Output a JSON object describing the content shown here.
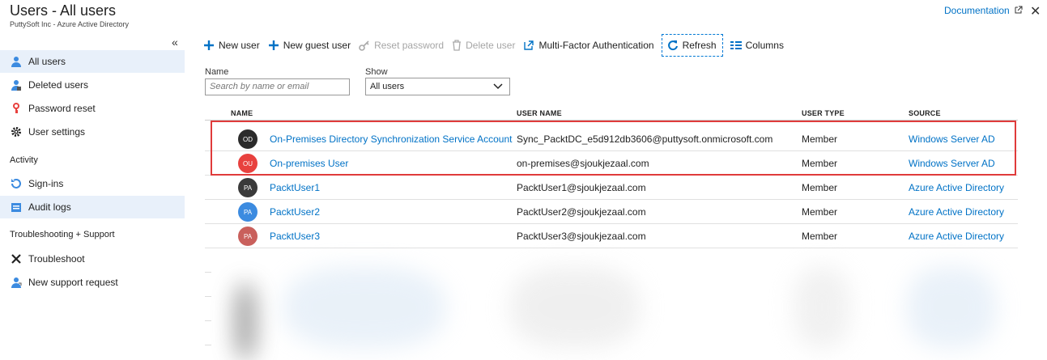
{
  "header": {
    "title": "Users - All users",
    "subtitle": "PuttySoft Inc - Azure Active Directory",
    "documentation": "Documentation",
    "close": "✕"
  },
  "sidebar": {
    "collapse": "«",
    "items": [
      {
        "label": "All users",
        "icon": "user-icon"
      },
      {
        "label": "Deleted users",
        "icon": "deleted-user-icon"
      },
      {
        "label": "Password reset",
        "icon": "key-icon"
      },
      {
        "label": "User settings",
        "icon": "gear-icon"
      }
    ],
    "activity_label": "Activity",
    "activity_items": [
      {
        "label": "Sign-ins",
        "icon": "sign-in-icon"
      },
      {
        "label": "Audit logs",
        "icon": "log-icon"
      }
    ],
    "support_label": "Troubleshooting + Support",
    "support_items": [
      {
        "label": "Troubleshoot",
        "icon": "wrench-icon"
      },
      {
        "label": "New support request",
        "icon": "support-icon"
      }
    ]
  },
  "toolbar": {
    "new_user": "New user",
    "new_guest_user": "New guest user",
    "reset_password": "Reset password",
    "delete_user": "Delete user",
    "mfa": "Multi-Factor Authentication",
    "refresh": "Refresh",
    "columns": "Columns"
  },
  "filters": {
    "name_label": "Name",
    "search_placeholder": "Search by name or email",
    "show_label": "Show",
    "show_value": "All users"
  },
  "table": {
    "headers": {
      "name": "NAME",
      "user_name": "USER NAME",
      "user_type": "USER TYPE",
      "source": "SOURCE"
    },
    "rows": [
      {
        "initials": "OD",
        "color": "#2b2b2b",
        "name": "On-Premises Directory Synchronization Service Account",
        "user_name": "Sync_PacktDC_e5d912db3606@puttysoft.onmicrosoft.com",
        "user_type": "Member",
        "source": "Windows Server AD"
      },
      {
        "initials": "OU",
        "color": "#e8413e",
        "name": "On-premises User",
        "user_name": "on-premises@sjoukjezaal.com",
        "user_type": "Member",
        "source": "Windows Server AD"
      },
      {
        "initials": "PA",
        "color": "#3a3a3a",
        "name": "PacktUser1",
        "user_name": "PacktUser1@sjoukjezaal.com",
        "user_type": "Member",
        "source": "Azure Active Directory"
      },
      {
        "initials": "PA",
        "color": "#3c8be0",
        "name": "PacktUser2",
        "user_name": "PacktUser2@sjoukjezaal.com",
        "user_type": "Member",
        "source": "Azure Active Directory"
      },
      {
        "initials": "PA",
        "color": "#c9605c",
        "name": "PacktUser3",
        "user_name": "PacktUser3@sjoukjezaal.com",
        "user_type": "Member",
        "source": "Azure Active Directory"
      }
    ]
  }
}
